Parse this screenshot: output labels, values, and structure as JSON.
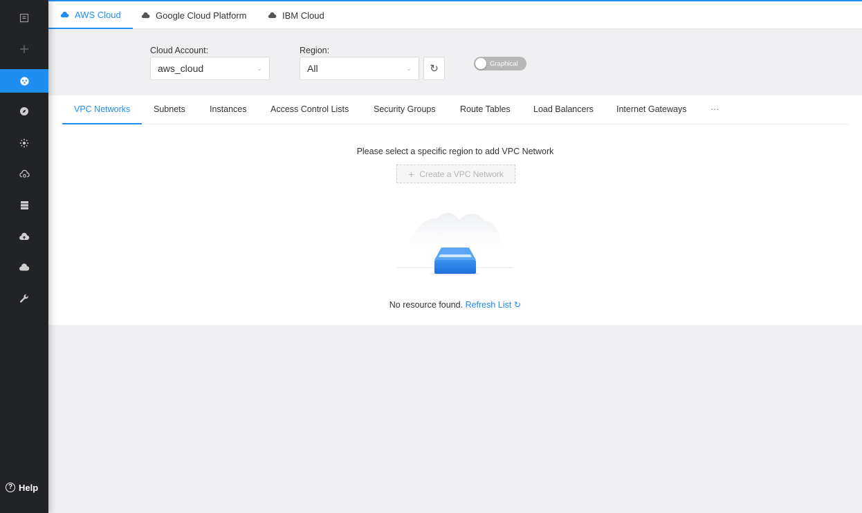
{
  "sidebar": {
    "items": [
      {
        "icon": "dashboard-icon"
      },
      {
        "icon": "plus-icon"
      },
      {
        "icon": "network-icon",
        "active": true
      },
      {
        "icon": "compass-icon"
      },
      {
        "icon": "cluster-icon"
      },
      {
        "icon": "cloud-sync-icon"
      },
      {
        "icon": "server-icon"
      },
      {
        "icon": "cloud-upload-icon"
      },
      {
        "icon": "cloud-icon"
      },
      {
        "icon": "wrench-icon"
      }
    ],
    "help_label": "Help"
  },
  "cloud_tabs": [
    {
      "label": "AWS Cloud",
      "active": true
    },
    {
      "label": "Google Cloud Platform"
    },
    {
      "label": "IBM Cloud"
    }
  ],
  "filters": {
    "account_label": "Cloud Account:",
    "account_value": "aws_cloud",
    "region_label": "Region:",
    "region_value": "All",
    "toggle_label": "Graphical"
  },
  "subtabs": [
    {
      "label": "VPC Networks",
      "active": true
    },
    {
      "label": "Subnets"
    },
    {
      "label": "Instances"
    },
    {
      "label": "Access Control Lists"
    },
    {
      "label": "Security Groups"
    },
    {
      "label": "Route Tables"
    },
    {
      "label": "Load Balancers"
    },
    {
      "label": "Internet Gateways"
    },
    {
      "label": "···"
    }
  ],
  "empty_state": {
    "message": "Please select a specific region to add VPC Network",
    "create_label": "Create a VPC Network",
    "no_resource_text": "No resource found.",
    "refresh_label": "Refresh List"
  },
  "colors": {
    "accent": "#1f8ef1",
    "sidebar_bg": "#222326",
    "page_bg": "#f0f0f2"
  }
}
